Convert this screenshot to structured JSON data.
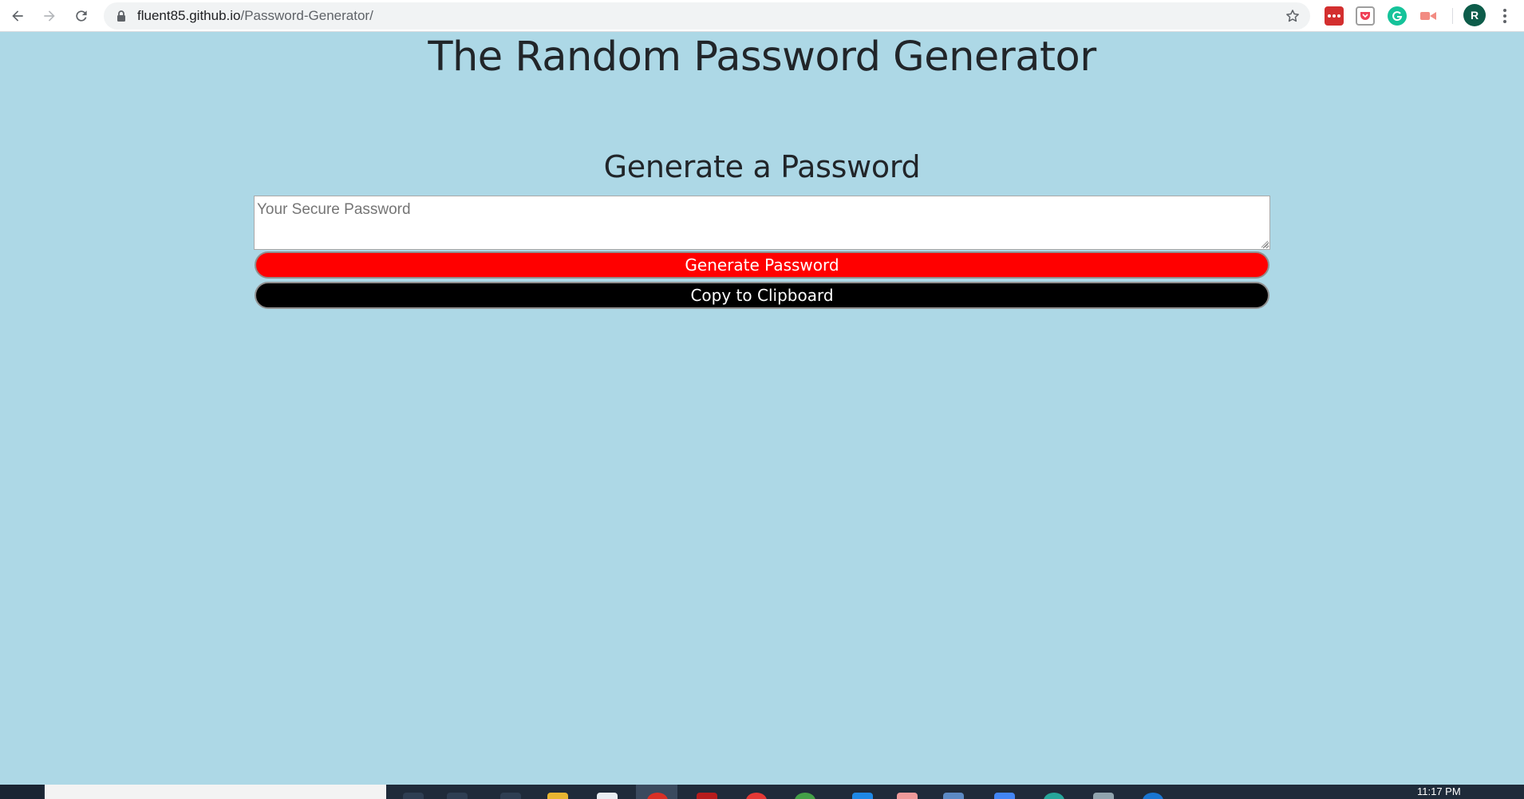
{
  "browser": {
    "url_domain": "fluent85.github.io",
    "url_path": "/Password-Generator/",
    "profile_initial": "R",
    "icons": {
      "back": "arrow-left-icon",
      "forward": "arrow-right-icon",
      "reload": "reload-icon",
      "lock": "lock-icon",
      "bookmark": "star-icon",
      "menu": "kebab-menu-icon"
    },
    "extensions": [
      "lastpass-icon",
      "pocket-icon",
      "grammarly-icon",
      "screencast-icon"
    ]
  },
  "page": {
    "title": "The Random Password Generator",
    "subtitle": "Generate a Password",
    "password_placeholder": "Your Secure Password",
    "password_value": "",
    "generate_label": "Generate Password",
    "copy_label": "Copy to Clipboard"
  },
  "colors": {
    "page_background": "#add8e6",
    "generate_button": "#ff0000",
    "copy_button": "#000000"
  },
  "taskbar": {
    "clock": "11:17 PM"
  }
}
